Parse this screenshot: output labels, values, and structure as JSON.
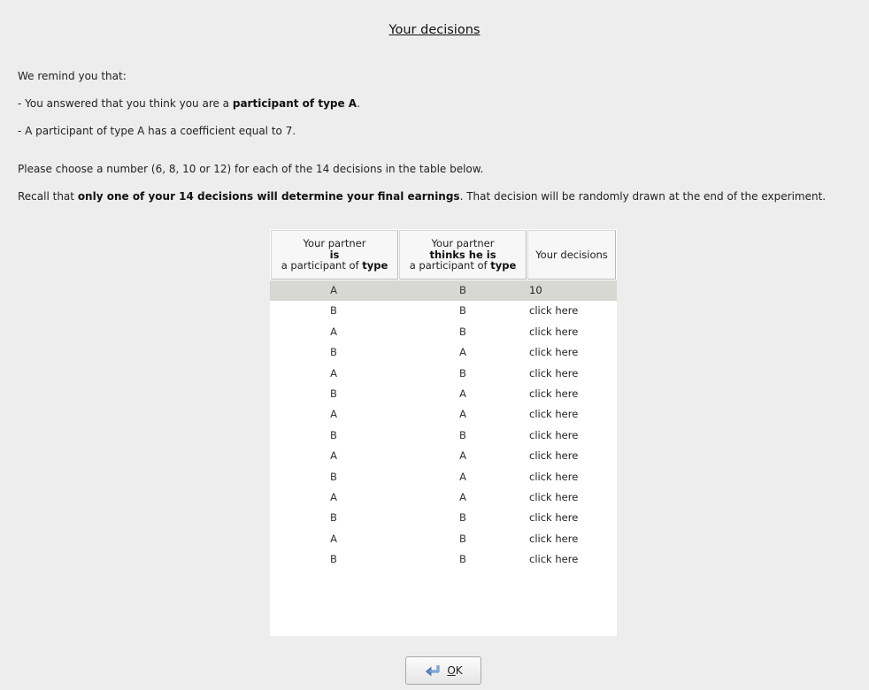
{
  "title": "Your decisions",
  "intro": {
    "remind": "We remind you that:",
    "answered_prefix": "- You answered that you think you are a ",
    "answered_bold": "participant of type  A",
    "answered_suffix": ".",
    "coefficient": "- A participant of type A has a coefficient equal to 7.",
    "choose": "Please choose a number (6, 8, 10 or 12) for each of the 14 decisions in the table below.",
    "recall_prefix": "Recall that ",
    "recall_bold": "only one of your 14 decisions will determine your final earnings",
    "recall_suffix": ". That decision will be randomly drawn at the end of the experiment."
  },
  "table": {
    "headers": {
      "partner_is": {
        "line1": "Your partner",
        "line2": "is",
        "line3_prefix": "a participant of ",
        "line3_bold": "type"
      },
      "partner_thinks": {
        "line1": "Your partner",
        "line2": "thinks he is",
        "line3_prefix": "a participant of ",
        "line3_bold": "type"
      },
      "decisions": "Your decisions"
    },
    "rows": [
      {
        "is": "A",
        "thinks": "B",
        "decision": "10"
      },
      {
        "is": "B",
        "thinks": "B",
        "decision": "click here"
      },
      {
        "is": "A",
        "thinks": "B",
        "decision": "click here"
      },
      {
        "is": "B",
        "thinks": "A",
        "decision": "click here"
      },
      {
        "is": "A",
        "thinks": "B",
        "decision": "click here"
      },
      {
        "is": "B",
        "thinks": "A",
        "decision": "click here"
      },
      {
        "is": "A",
        "thinks": "A",
        "decision": "click here"
      },
      {
        "is": "B",
        "thinks": "B",
        "decision": "click here"
      },
      {
        "is": "A",
        "thinks": "A",
        "decision": "click here"
      },
      {
        "is": "B",
        "thinks": "A",
        "decision": "click here"
      },
      {
        "is": "A",
        "thinks": "A",
        "decision": "click here"
      },
      {
        "is": "B",
        "thinks": "B",
        "decision": "click here"
      },
      {
        "is": "A",
        "thinks": "B",
        "decision": "click here"
      },
      {
        "is": "B",
        "thinks": "B",
        "decision": "click here"
      }
    ]
  },
  "ok_button": {
    "mnemonic": "O",
    "rest": "K",
    "icon": "ok-arrow-icon"
  }
}
